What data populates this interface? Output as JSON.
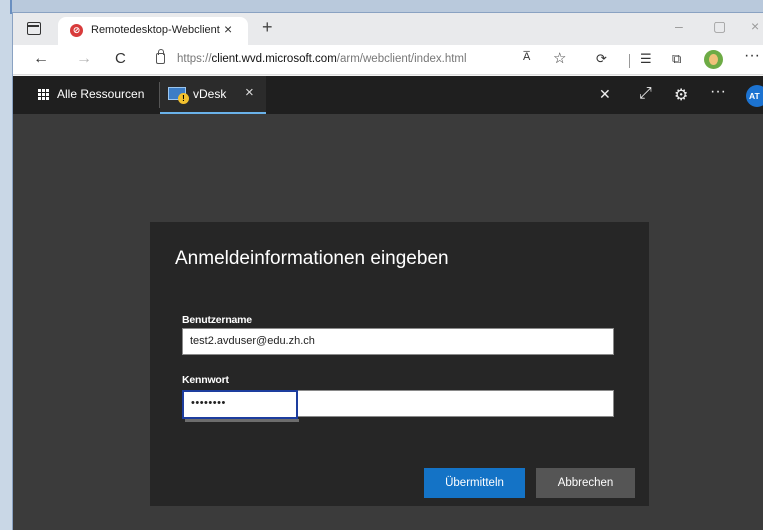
{
  "browser": {
    "tab": {
      "title": "Remotedesktop-Webclient",
      "close_glyph": "×",
      "favicon": "remote-desktop-icon"
    },
    "new_tab_glyph": "+",
    "window_controls": {
      "minimize": "–",
      "maximize": "▢",
      "close": "×"
    },
    "navigation": {
      "back": "←",
      "forward": "→",
      "refresh": "C"
    },
    "address": {
      "protocol": "https://",
      "host": "client.wvd.microsoft.com",
      "path": "/arm/webclient/index.html"
    },
    "toolbar_icons": {
      "read_aloud": "A̅",
      "favorite": "☆",
      "extensions": "⟳",
      "favorites_list": "☰",
      "collections": "⧉",
      "more": "···"
    }
  },
  "app_header": {
    "all_resources_label": "Alle Ressourcen",
    "session_tab_label": "vDesk",
    "session_tab_close": "×",
    "warning_glyph": "!",
    "icons": {
      "pin": "✕",
      "fullscreen": "⤢",
      "settings": "⚙",
      "more": "···"
    },
    "avatar_initials": "AT"
  },
  "dialog": {
    "title": "Anmeldeinformationen eingeben",
    "username_label": "Benutzername",
    "username_value": "test2.avduser@edu.zh.ch",
    "password_label": "Kennwort",
    "password_value": "••••••••",
    "submit_label": "Übermitteln",
    "cancel_label": "Abbrechen"
  },
  "colors": {
    "app_header_bg": "#1f1f1f",
    "main_bg": "#3b3b3b",
    "dialog_bg": "#262626",
    "primary_button": "#1473c6",
    "secondary_button": "#555555",
    "active_tab_accent": "#6ab2ea",
    "avatar_bg": "#1c73d1"
  }
}
